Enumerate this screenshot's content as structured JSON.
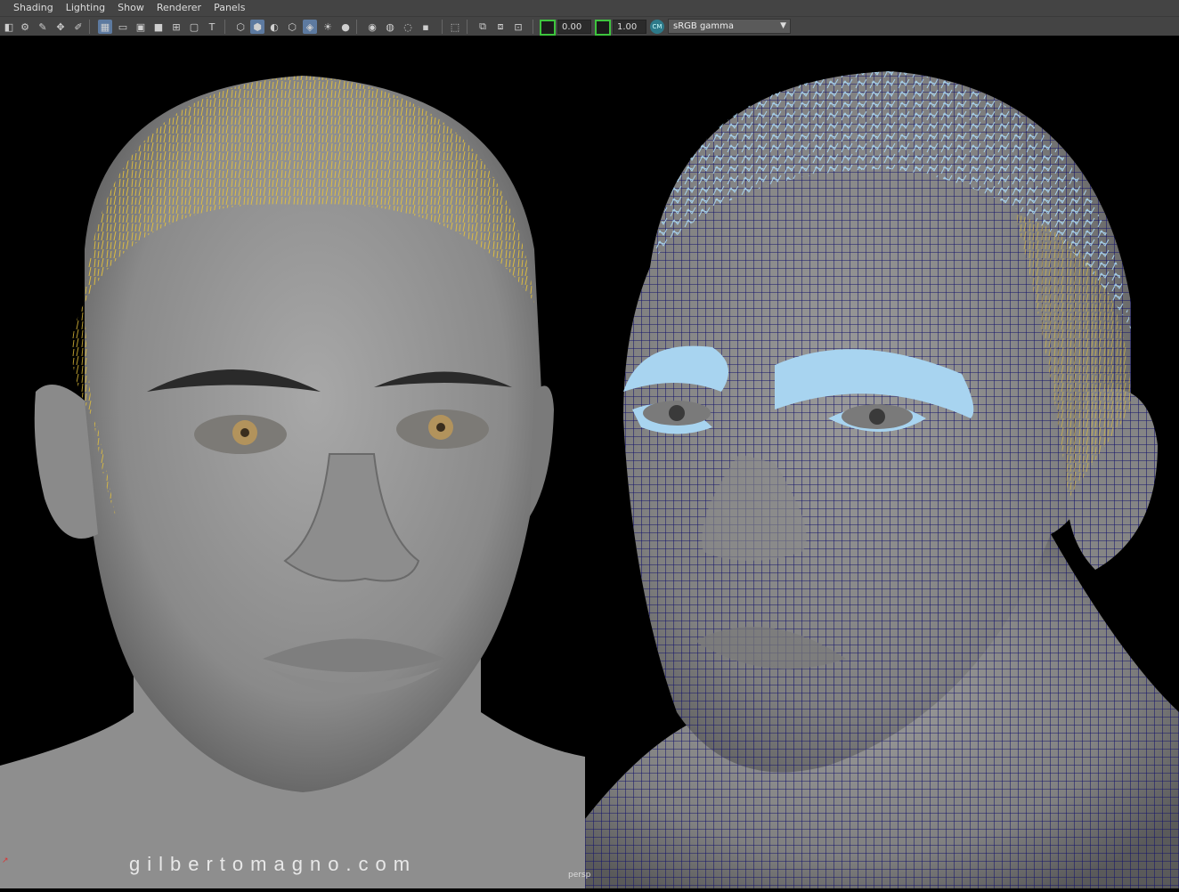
{
  "menu": [
    "Shading",
    "Lighting",
    "Show",
    "Renderer",
    "Panels"
  ],
  "toolbar": {
    "exposure": "0.00",
    "gamma": "1.00",
    "color_space": "sRGB gamma"
  },
  "viewport": {
    "camera_label": "persp",
    "watermark": "gilbertomagno.com"
  },
  "colors": {
    "wire": "#1a1a6e",
    "hair_yellow": "#e6c23a",
    "hair_blue": "#a8d4f0",
    "skin_gray": "#8a8a8a"
  }
}
